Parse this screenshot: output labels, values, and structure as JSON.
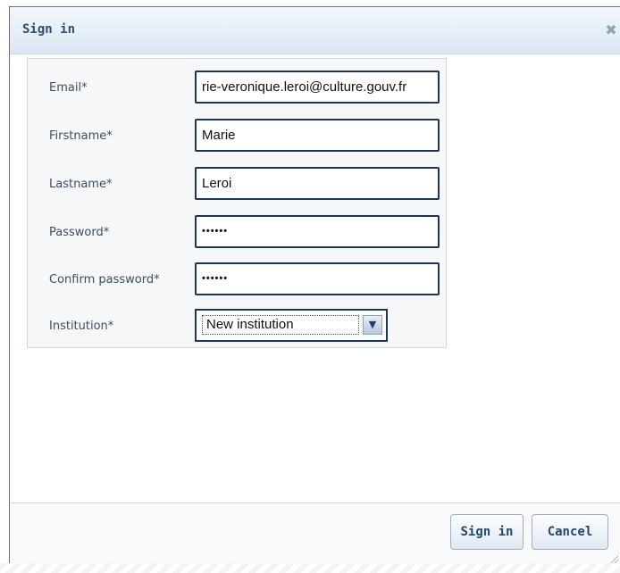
{
  "dialog": {
    "title": "Sign in",
    "close_icon": "close-icon"
  },
  "form": {
    "fields": [
      {
        "label": "Email*",
        "value": "rie-veronique.leroi@culture.gouv.fr"
      },
      {
        "label": "Firstname*",
        "value": "Marie"
      },
      {
        "label": "Lastname*",
        "value": "Leroi"
      },
      {
        "label": "Password*",
        "value": "••••••"
      },
      {
        "label": "Confirm password*",
        "value": "••••••"
      }
    ],
    "institution": {
      "label": "Institution*",
      "selected": "New institution"
    }
  },
  "footer": {
    "signin_label": "Sign in",
    "cancel_label": "Cancel"
  },
  "colors": {
    "title": "#2d4f73",
    "field_border": "#1c3657"
  }
}
